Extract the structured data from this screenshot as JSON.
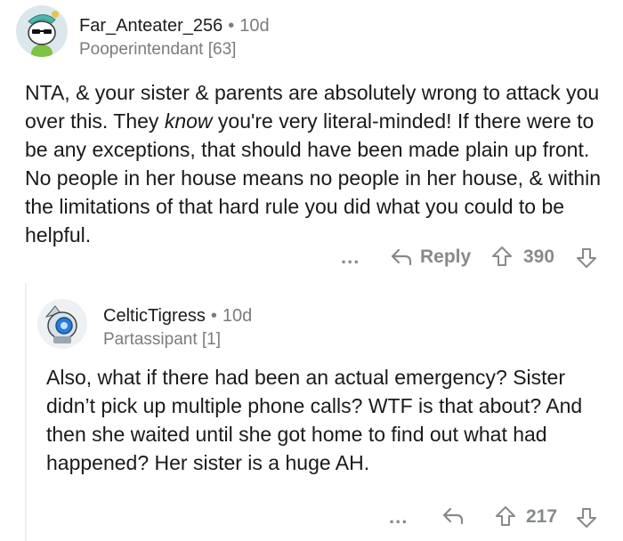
{
  "comments": [
    {
      "username": "Far_Anteater_256",
      "separator": "•",
      "age": "10d",
      "flair": "Pooperintendant [63]",
      "body_before_em": "NTA, & your sister & parents are absolutely wrong to attack you over this. They ",
      "body_em": "know",
      "body_after_em": " you're very literal-minded! If there were to be any exceptions, that should have been made plain up front. No people in her house means no people in her house, & within the limitations of that hard rule you did what you could to be helpful.",
      "more": "...",
      "reply_label": "Reply",
      "score": "390",
      "colors": {
        "avatar_bg": "#e9eef0"
      },
      "icons": [
        "more-icon",
        "reply-icon",
        "upvote-icon",
        "downvote-icon"
      ]
    },
    {
      "username": "CelticTigress",
      "separator": "•",
      "age": "10d",
      "flair": "Partassipant [1]",
      "body": "Also, what if there had been an actual emergency? Sister didn’t pick up multiple phone calls? WTF is that about? And then she waited until she got home to find out what had happened? Her sister is a huge AH.",
      "more": "...",
      "score": "217",
      "colors": {
        "avatar_bg": "#eef1f3"
      },
      "icons": [
        "more-icon",
        "reply-icon",
        "upvote-icon",
        "downvote-icon"
      ]
    }
  ]
}
